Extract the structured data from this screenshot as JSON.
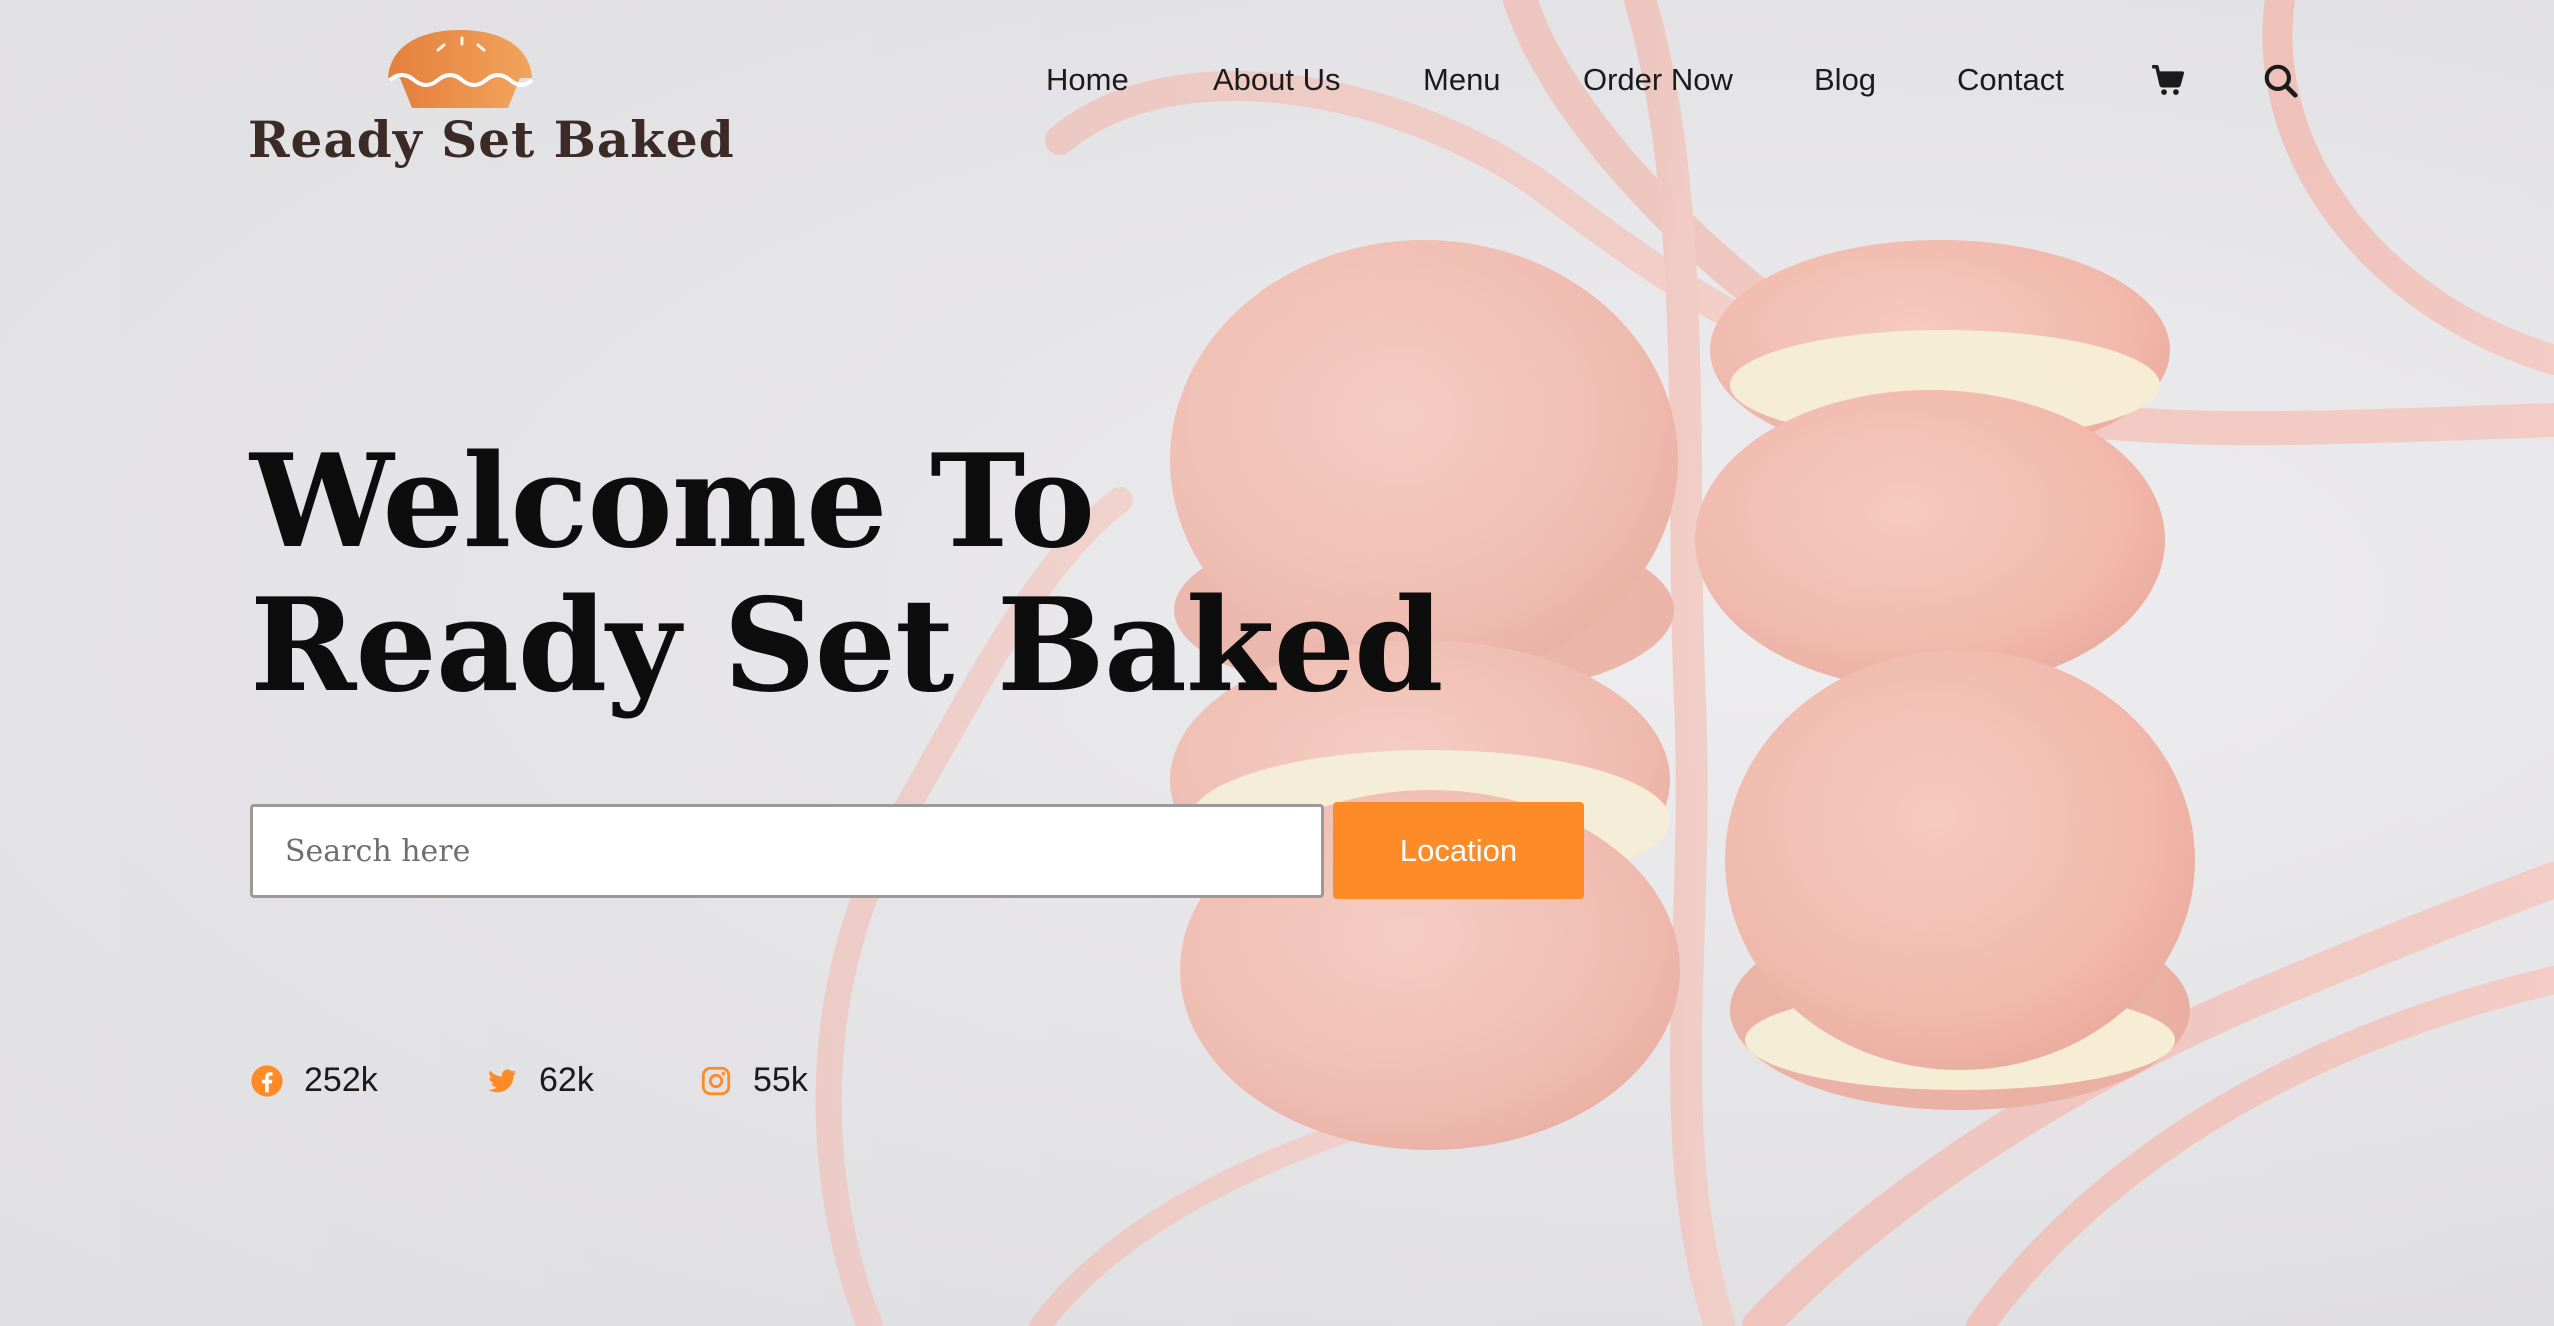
{
  "brand": {
    "name": "Ready Set Baked",
    "accent_color": "#fd8b28",
    "logo_icon": "pie-icon"
  },
  "nav": {
    "items": [
      {
        "label": "Home"
      },
      {
        "label": "About Us"
      },
      {
        "label": "Menu"
      },
      {
        "label": "Order Now"
      },
      {
        "label": "Blog"
      },
      {
        "label": "Contact"
      }
    ],
    "cart_icon": "cart-icon",
    "search_icon": "search-icon"
  },
  "hero": {
    "title_line1": "Welcome To",
    "title_line2": "Ready Set Baked"
  },
  "search": {
    "placeholder": "Search here",
    "value": "",
    "button_label": "Location"
  },
  "social": [
    {
      "icon": "facebook-icon",
      "count": "252k"
    },
    {
      "icon": "twitter-icon",
      "count": "62k"
    },
    {
      "icon": "instagram-icon",
      "count": "55k"
    }
  ]
}
